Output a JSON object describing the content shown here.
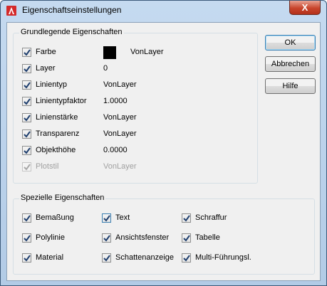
{
  "window": {
    "title": "Eigenschaftseinstellungen",
    "close_glyph": "X",
    "icon": "autocad-icon"
  },
  "basic": {
    "title": "Grundlegende Eigenschaften",
    "items": [
      {
        "label": "Farbe",
        "value": "VonLayer",
        "checked": true,
        "enabled": true,
        "swatch": "#000000"
      },
      {
        "label": "Layer",
        "value": "0",
        "checked": true,
        "enabled": true
      },
      {
        "label": "Linientyp",
        "value": "VonLayer",
        "checked": true,
        "enabled": true
      },
      {
        "label": "Linientypfaktor",
        "value": "1.0000",
        "checked": true,
        "enabled": true
      },
      {
        "label": "Linienstärke",
        "value": "VonLayer",
        "checked": true,
        "enabled": true
      },
      {
        "label": "Transparenz",
        "value": "VonLayer",
        "checked": true,
        "enabled": true
      },
      {
        "label": "Objekthöhe",
        "value": "0.0000",
        "checked": true,
        "enabled": true
      },
      {
        "label": "Plotstil",
        "value": "VonLayer",
        "checked": true,
        "enabled": false
      }
    ]
  },
  "special": {
    "title": "Spezielle Eigenschaften",
    "items": [
      {
        "label": "Bemaßung",
        "checked": true
      },
      {
        "label": "Text",
        "checked": true
      },
      {
        "label": "Schraffur",
        "checked": true
      },
      {
        "label": "Polylinie",
        "checked": true
      },
      {
        "label": "Ansichtsfenster",
        "checked": true
      },
      {
        "label": "Tabelle",
        "checked": true
      },
      {
        "label": "Material",
        "checked": true
      },
      {
        "label": "Schattenanzeige",
        "checked": true
      },
      {
        "label": "Multi-Führungsl.",
        "checked": true
      }
    ]
  },
  "buttons": {
    "ok": "OK",
    "cancel": "Abbrechen",
    "help": "Hilfe"
  }
}
